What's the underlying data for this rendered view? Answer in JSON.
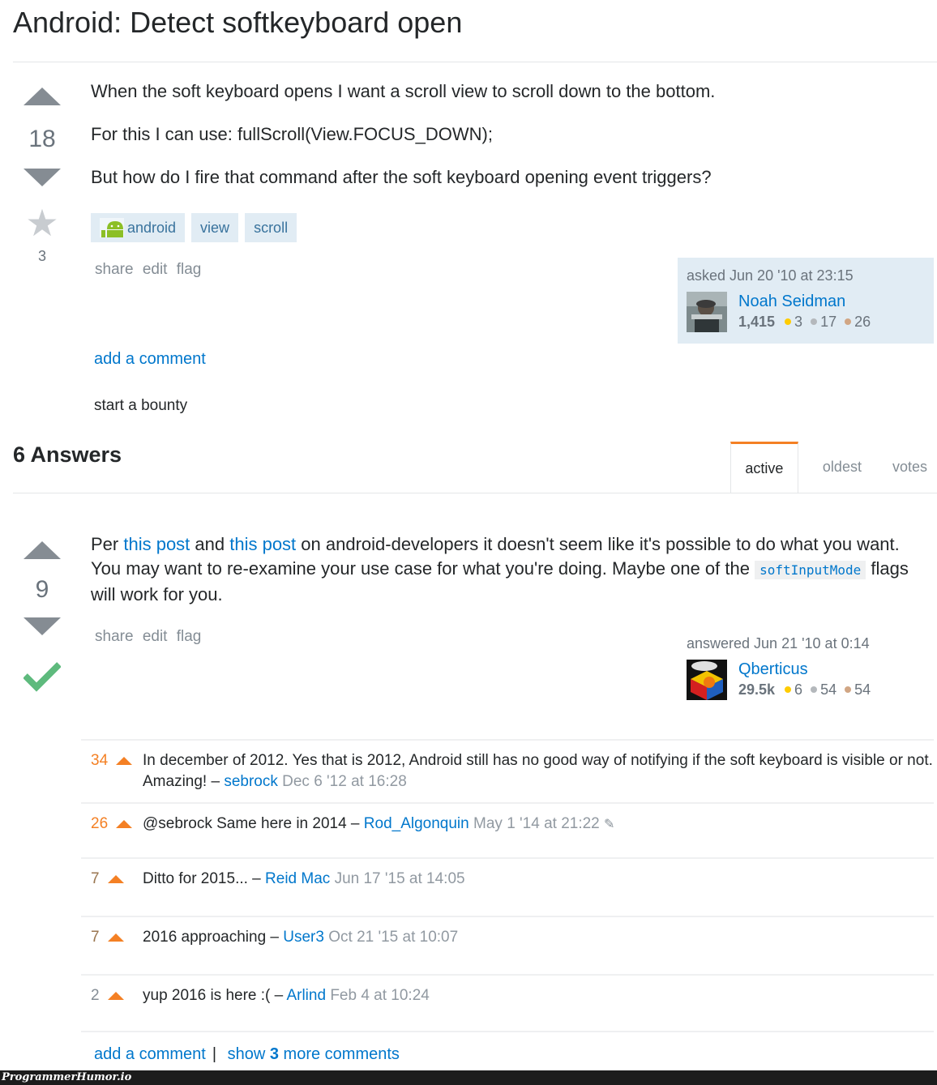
{
  "question": {
    "title": "Android: Detect softkeyboard open",
    "votes": "18",
    "favorites": "3",
    "body": [
      "When the soft keyboard opens I want a scroll view to scroll down to the bottom.",
      "For this I can use: fullScroll(View.FOCUS_DOWN);",
      "But how do I fire that command after the soft keyboard opening event triggers?"
    ],
    "tags": [
      "android",
      "view",
      "scroll"
    ],
    "menu": {
      "share": "share",
      "edit": "edit",
      "flag": "flag"
    },
    "signature": {
      "action": "asked Jun 20 '10 at 23:15",
      "user": "Noah Seidman",
      "reputation": "1,415",
      "gold": "3",
      "silver": "17",
      "bronze": "26"
    },
    "add_comment": "add a comment",
    "start_bounty": "start a bounty"
  },
  "answers_header": {
    "count_label": "6 Answers",
    "tabs": [
      {
        "label": "active",
        "active": true
      },
      {
        "label": "oldest",
        "active": false
      },
      {
        "label": "votes",
        "active": false
      }
    ]
  },
  "answer": {
    "votes": "9",
    "accepted": true,
    "body": {
      "per": "Per ",
      "link1": "this post",
      "and": " and ",
      "link2": "this post",
      "rest": " on android-developers it doesn't seem like it's possible to do what you want. You may want to re-examine your use case for what you're doing. Maybe one of the ",
      "code": "softInputMode",
      "end": " flags will work for you."
    },
    "menu": {
      "share": "share",
      "edit": "edit",
      "flag": "flag"
    },
    "signature": {
      "action": "answered Jun 21 '10 at 0:14",
      "user": "Qberticus",
      "reputation": "29.5k",
      "gold": "6",
      "silver": "54",
      "bronze": "54"
    },
    "comments": [
      {
        "score": "34",
        "text": "In december of 2012. Yes that is 2012, Android still has no good way of notifying if the soft keyboard is visible or not. Amazing! – ",
        "user": "sebrock",
        "date": "Dec 6 '12 at 16:28",
        "edited": false
      },
      {
        "score": "26",
        "text": "@sebrock Same here in 2014 – ",
        "user": "Rod_Algonquin",
        "date": "May 1 '14 at 21:22",
        "edited": true
      },
      {
        "score": "7",
        "text": "Ditto for 2015... – ",
        "user": "Reid Mac",
        "date": "Jun 17 '15 at 14:05",
        "edited": false
      },
      {
        "score": "7",
        "text": "2016 approaching – ",
        "user": "User3",
        "date": "Oct 21 '15 at 10:07",
        "edited": false
      },
      {
        "score": "2",
        "text": "yup 2016 is here :( – ",
        "user": "Arlind",
        "date": "Feb 4 at 10:24",
        "edited": false
      }
    ],
    "add_comment": "add a comment",
    "separator": "|",
    "show_more_prefix": "show ",
    "show_more_count": "3",
    "show_more_suffix": " more comments"
  },
  "colors": {
    "link": "#0077cc",
    "accent": "#f48024",
    "tag_bg": "#e1ecf4",
    "tag_text": "#39739d",
    "accepted": "#5eba7d",
    "gold": "#ffcc01",
    "silver": "#b4b8bc",
    "bronze": "#d1a684"
  },
  "watermark": "ProgrammerHumor.io"
}
